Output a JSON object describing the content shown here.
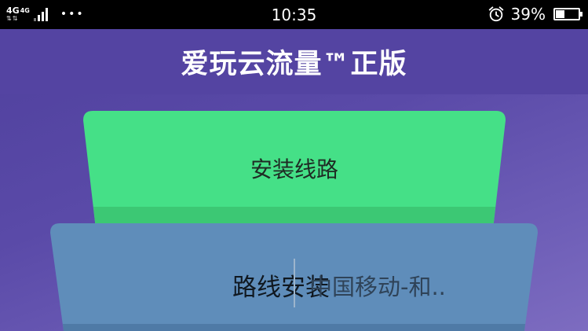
{
  "status_bar": {
    "network_label": "4G",
    "network_label_2": "4G",
    "network_arrows": "⇅⇅",
    "more_dots": "•••",
    "time": "10:35",
    "battery_percent": "39%",
    "battery_level": 0.39
  },
  "header": {
    "title": "爱玩云流量™正版"
  },
  "main": {
    "install_button_label": "安装线路",
    "route_label": "路线安装",
    "route_selected_value": "中国移动-和.."
  },
  "colors": {
    "accent_green": "#45e087",
    "accent_green_shadow": "#3cc874",
    "card_blue": "#5f8dba",
    "card_blue_shadow": "#4f7aa6",
    "header_purple": "#5444a2"
  }
}
